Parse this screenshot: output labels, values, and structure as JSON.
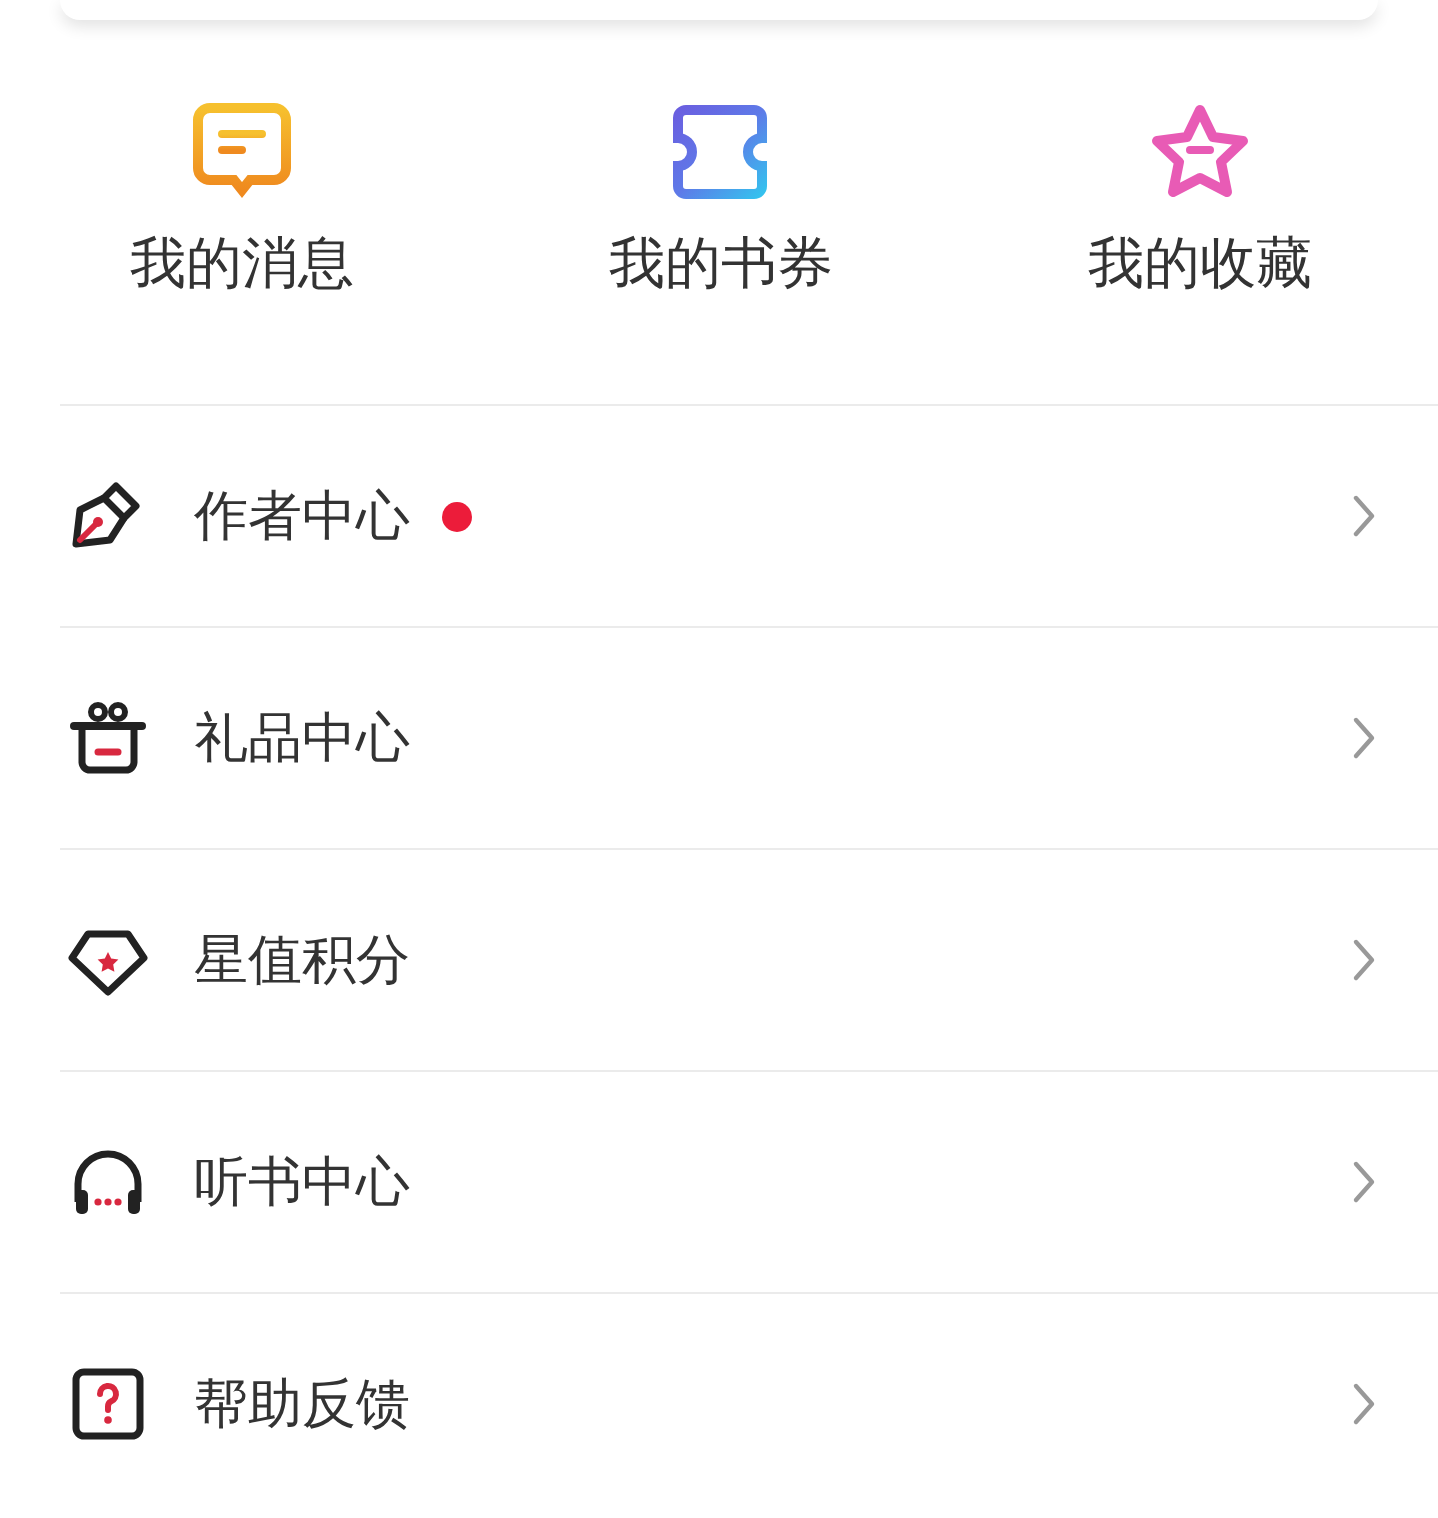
{
  "shortcuts": [
    {
      "label": "我的消息"
    },
    {
      "label": "我的书券"
    },
    {
      "label": "我的收藏"
    }
  ],
  "menu": [
    {
      "label": "作者中心",
      "dot": true
    },
    {
      "label": "礼品中心",
      "dot": false
    },
    {
      "label": "星值积分",
      "dot": false
    },
    {
      "label": "听书中心",
      "dot": false
    },
    {
      "label": "帮助反馈",
      "dot": false
    }
  ]
}
